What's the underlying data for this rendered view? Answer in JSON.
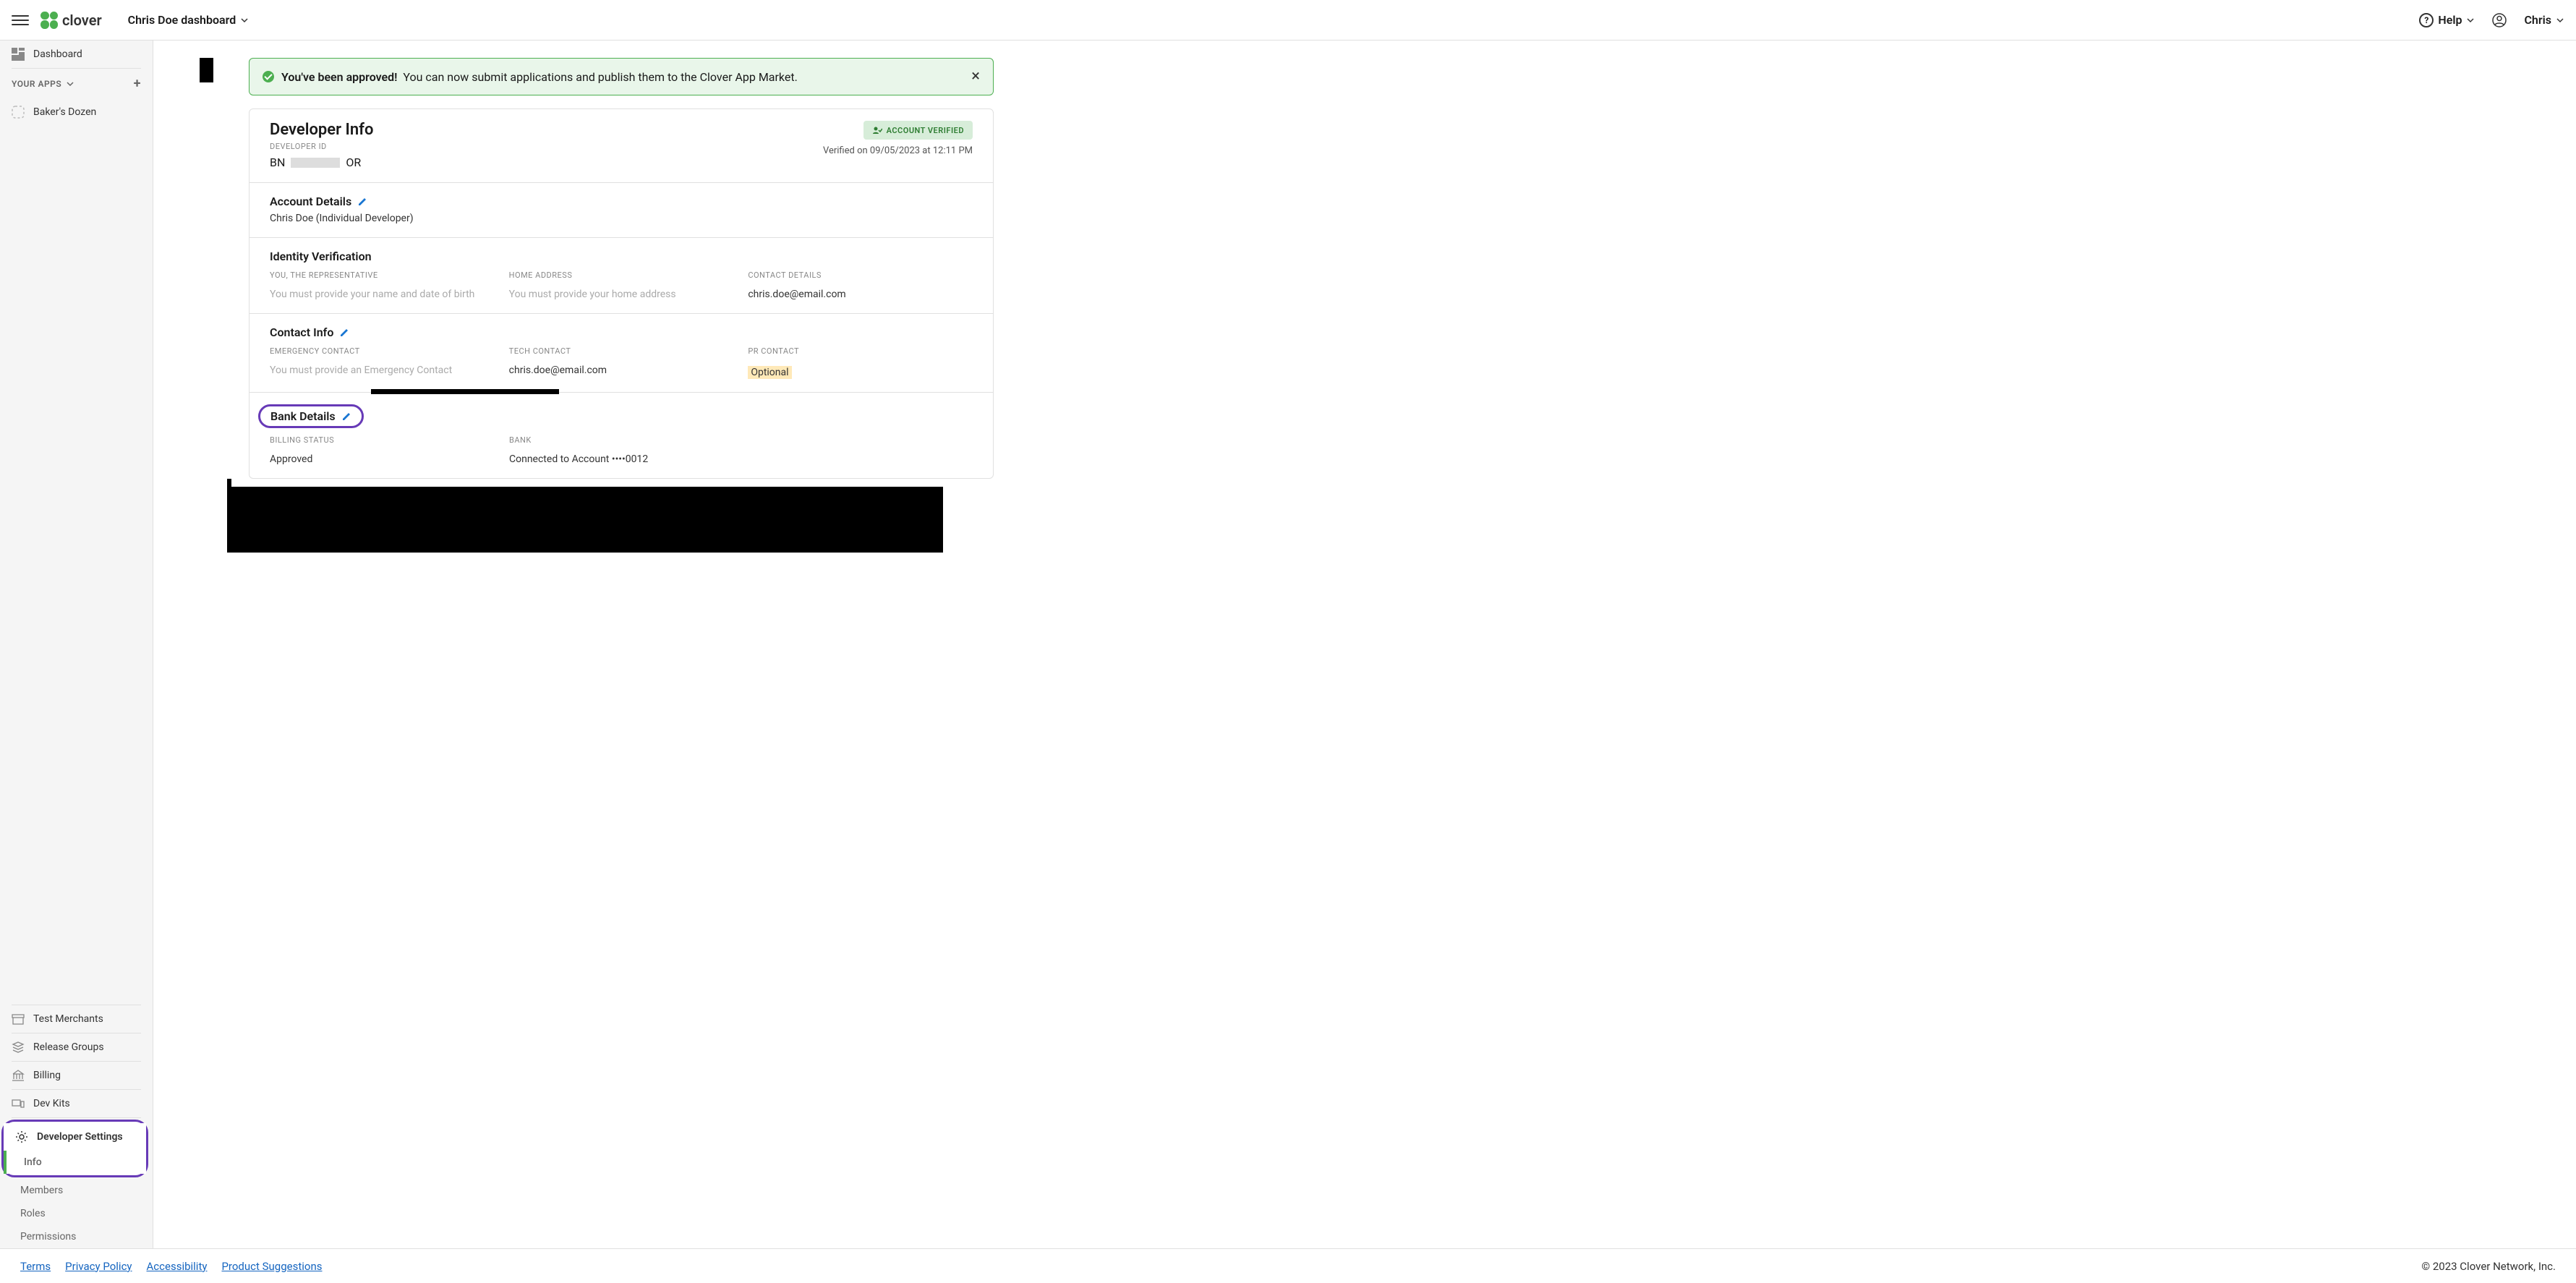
{
  "topbar": {
    "dashboard_label": "Chris Doe dashboard",
    "help_label": "Help",
    "user_label": "Chris",
    "logo_text": "clover"
  },
  "sidebar": {
    "dashboard": "Dashboard",
    "your_apps_label": "YOUR APPS",
    "apps": [
      {
        "name": "Baker's Dozen"
      }
    ],
    "test_merchants": "Test Merchants",
    "release_groups": "Release Groups",
    "billing": "Billing",
    "dev_kits": "Dev Kits",
    "developer_settings": "Developer Settings",
    "subs": {
      "info": "Info",
      "members": "Members",
      "roles": "Roles",
      "permissions": "Permissions"
    }
  },
  "alert": {
    "strong": "You've been approved!",
    "rest": "You can now submit applications and publish them to the Clover App Market."
  },
  "dev_info": {
    "title": "Developer Info",
    "id_label": "DEVELOPER ID",
    "id_prefix": "BN",
    "id_suffix": "OR",
    "badge": "ACCOUNT VERIFIED",
    "verified_on": "Verified on 09/05/2023 at 12:11 PM"
  },
  "account_details": {
    "title": "Account Details",
    "name_line": "Chris Doe (Individual Developer)"
  },
  "identity": {
    "title": "Identity Verification",
    "you_label": "YOU, THE REPRESENTATIVE",
    "you_ph": "You must provide your name and date of birth",
    "home_label": "HOME ADDRESS",
    "home_ph": "You must provide your home address",
    "contact_label": "CONTACT DETAILS",
    "contact_value": "chris.doe@email.com"
  },
  "contact_info": {
    "title": "Contact Info",
    "emergency_label": "EMERGENCY CONTACT",
    "emergency_ph": "You must provide an Emergency Contact",
    "tech_label": "TECH CONTACT",
    "tech_value": "chris.doe@email.com",
    "pr_label": "PR CONTACT",
    "pr_ph": "Optional"
  },
  "bank": {
    "title": "Bank Details",
    "billing_status_label": "BILLING STATUS",
    "billing_status": "Approved",
    "bank_label": "BANK",
    "bank_value": "Connected to Account ••••0012"
  },
  "footer": {
    "terms": "Terms",
    "privacy": "Privacy Policy",
    "accessibility": "Accessibility",
    "suggestions": "Product Suggestions",
    "copyright": "© 2023 Clover Network, Inc."
  }
}
